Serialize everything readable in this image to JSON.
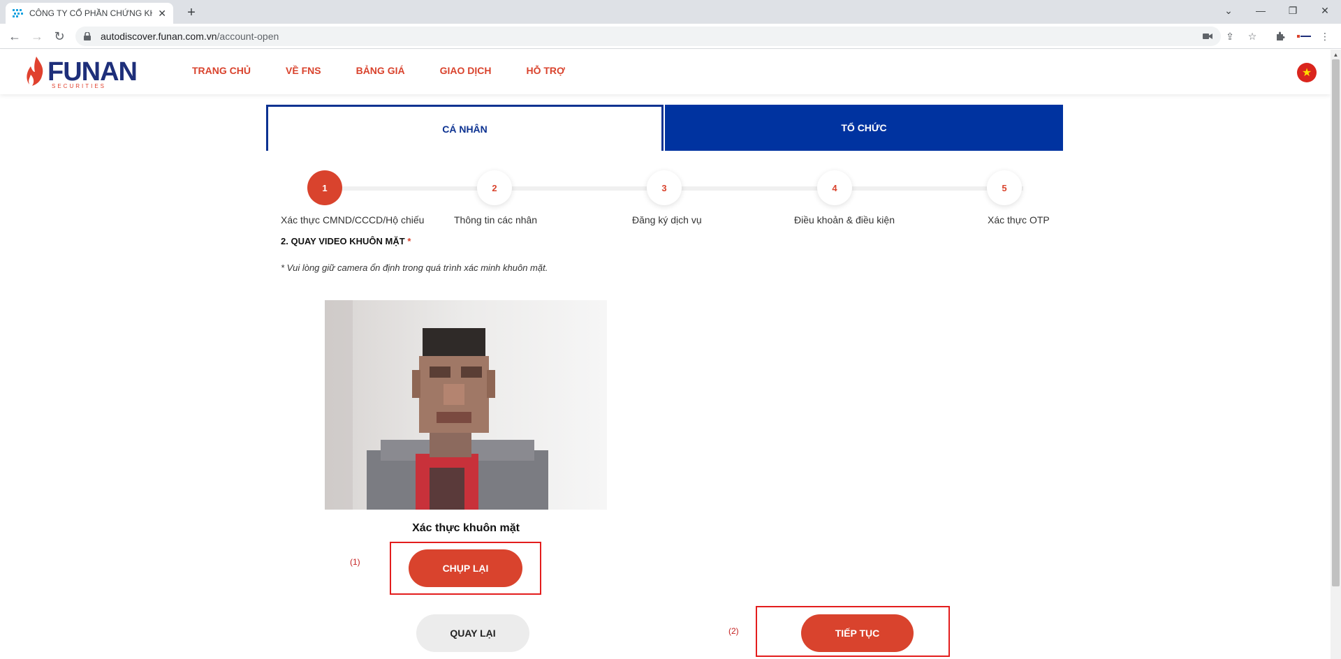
{
  "browser": {
    "tab_title": "CÔNG TY CỔ PHẦN CHỨNG KHO",
    "url_domain": "autodiscover.funan.com.vn",
    "url_path": "/account-open"
  },
  "header": {
    "logo_text": "FUNAN",
    "logo_sub": "SECURITIES",
    "nav": [
      "TRANG CHỦ",
      "VỀ FNS",
      "BẢNG GIÁ",
      "GIAO DỊCH",
      "HỖ TRỢ"
    ]
  },
  "account_tabs": {
    "individual": "CÁ NHÂN",
    "organization": "TỔ CHỨC"
  },
  "steps": [
    {
      "num": "1",
      "label": "Xác thực CMND/CCCD/Hộ chiếu"
    },
    {
      "num": "2",
      "label": "Thông tin các nhân"
    },
    {
      "num": "3",
      "label": "Đăng ký dịch vụ"
    },
    {
      "num": "4",
      "label": "Điều khoản & điều kiện"
    },
    {
      "num": "5",
      "label": "Xác thực OTP"
    }
  ],
  "section": {
    "title": "2. QUAY VIDEO KHUÔN MẶT",
    "required_mark": "*",
    "hint": "* Vui lòng giữ camera ổn định trong quá trình xác minh khuôn mặt.",
    "caption": "Xác thực khuôn mặt"
  },
  "buttons": {
    "retake": "CHỤP LẠI",
    "back": "QUAY LẠI",
    "next": "TIẾP TỤC"
  },
  "annotations": {
    "first": "(1)",
    "second": "(2)"
  },
  "colors": {
    "brand_red": "#d9432d",
    "brand_blue": "#0033a0",
    "annotation_red": "#e31d1d"
  }
}
